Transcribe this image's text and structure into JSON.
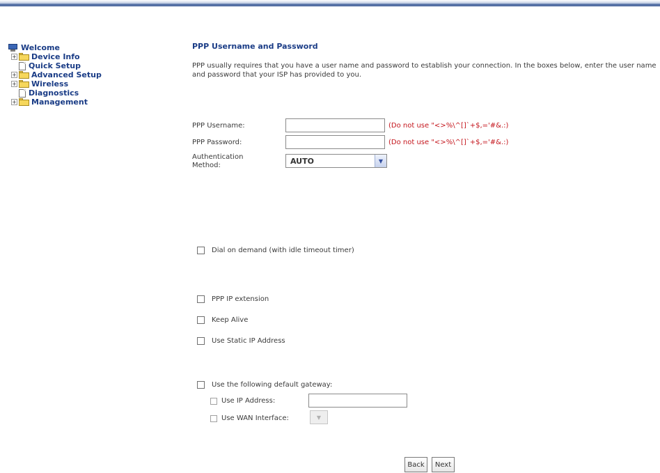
{
  "sidebar": {
    "items": [
      {
        "label": "Welcome",
        "icon": "monitor-icon"
      },
      {
        "label": "Device Info",
        "icon": "folder-icon",
        "expander": "+"
      },
      {
        "label": "Quick Setup",
        "icon": "page-icon"
      },
      {
        "label": "Advanced Setup",
        "icon": "folder-icon",
        "expander": "+"
      },
      {
        "label": "Wireless",
        "icon": "folder-icon",
        "expander": "+"
      },
      {
        "label": "Diagnostics",
        "icon": "page-icon"
      },
      {
        "label": "Management",
        "icon": "folder-icon",
        "expander": "+"
      }
    ]
  },
  "main": {
    "title": "PPP Username and Password",
    "description": "PPP usually requires that you have a user name and password to establish your connection. In the boxes below, enter the user name and password that your ISP has provided to you.",
    "username": {
      "label": "PPP Username:",
      "value": "",
      "hint": "(Do not use \"<>%\\^[]`+$,='#&.:)"
    },
    "password": {
      "label": "PPP Password:",
      "value": "",
      "hint": "(Do not use \"<>%\\^[]`+$,='#&.:)"
    },
    "auth": {
      "label": "Authentication Method:",
      "value": "AUTO"
    },
    "dial_on_demand": {
      "label": "Dial on demand (with idle timeout timer)",
      "checked": false
    },
    "ppp_ip_extension": {
      "label": "PPP IP extension",
      "checked": false
    },
    "keep_alive": {
      "label": "Keep Alive",
      "checked": false
    },
    "use_static_ip": {
      "label": "Use Static IP Address",
      "checked": false
    },
    "default_gateway": {
      "label": "Use the following default gateway:",
      "checked": false,
      "use_ip_label": "Use IP Address:",
      "use_ip_value": "",
      "use_wan_label": "Use WAN Interface:",
      "use_wan_value": ""
    },
    "buttons": {
      "back": "Back",
      "next": "Next"
    }
  },
  "colors": {
    "accent": "#1a3c86",
    "hint": "#c4151c",
    "topbar": "#3c5b96",
    "folder": "#f6d75c"
  }
}
